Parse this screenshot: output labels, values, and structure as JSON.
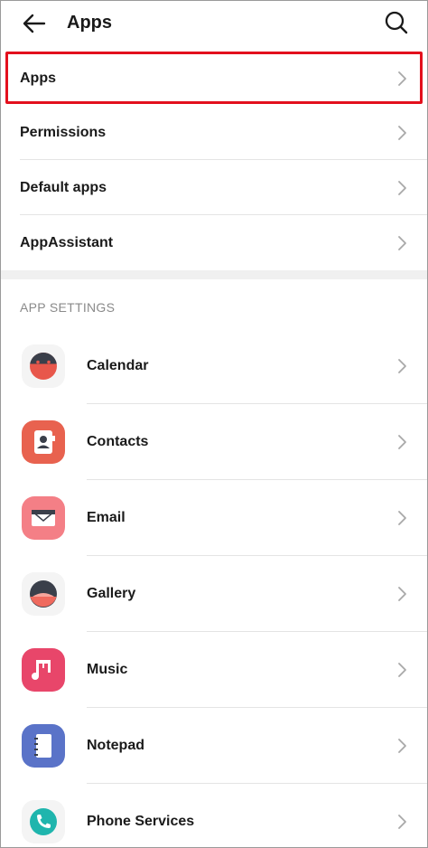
{
  "header": {
    "title": "Apps",
    "back_icon": "arrow-left-icon",
    "search_icon": "search-icon"
  },
  "menu": [
    {
      "label": "Apps",
      "highlighted": true
    },
    {
      "label": "Permissions"
    },
    {
      "label": "Default apps"
    },
    {
      "label": "AppAssistant"
    }
  ],
  "app_settings": {
    "header": "APP SETTINGS",
    "items": [
      {
        "label": "Calendar",
        "icon": "calendar-icon"
      },
      {
        "label": "Contacts",
        "icon": "contacts-icon"
      },
      {
        "label": "Email",
        "icon": "email-icon"
      },
      {
        "label": "Gallery",
        "icon": "gallery-icon"
      },
      {
        "label": "Music",
        "icon": "music-icon"
      },
      {
        "label": "Notepad",
        "icon": "notepad-icon"
      },
      {
        "label": "Phone Services",
        "icon": "phone-services-icon"
      }
    ]
  },
  "colors": {
    "highlight": "#e3101d",
    "calendar": "#e8574b",
    "contacts": "#e8624f",
    "email": "#f47f86",
    "gallery": "#ef6a5e",
    "music": "#e8466a",
    "notepad": "#5a73c8",
    "phone": "#1fb5ad"
  }
}
